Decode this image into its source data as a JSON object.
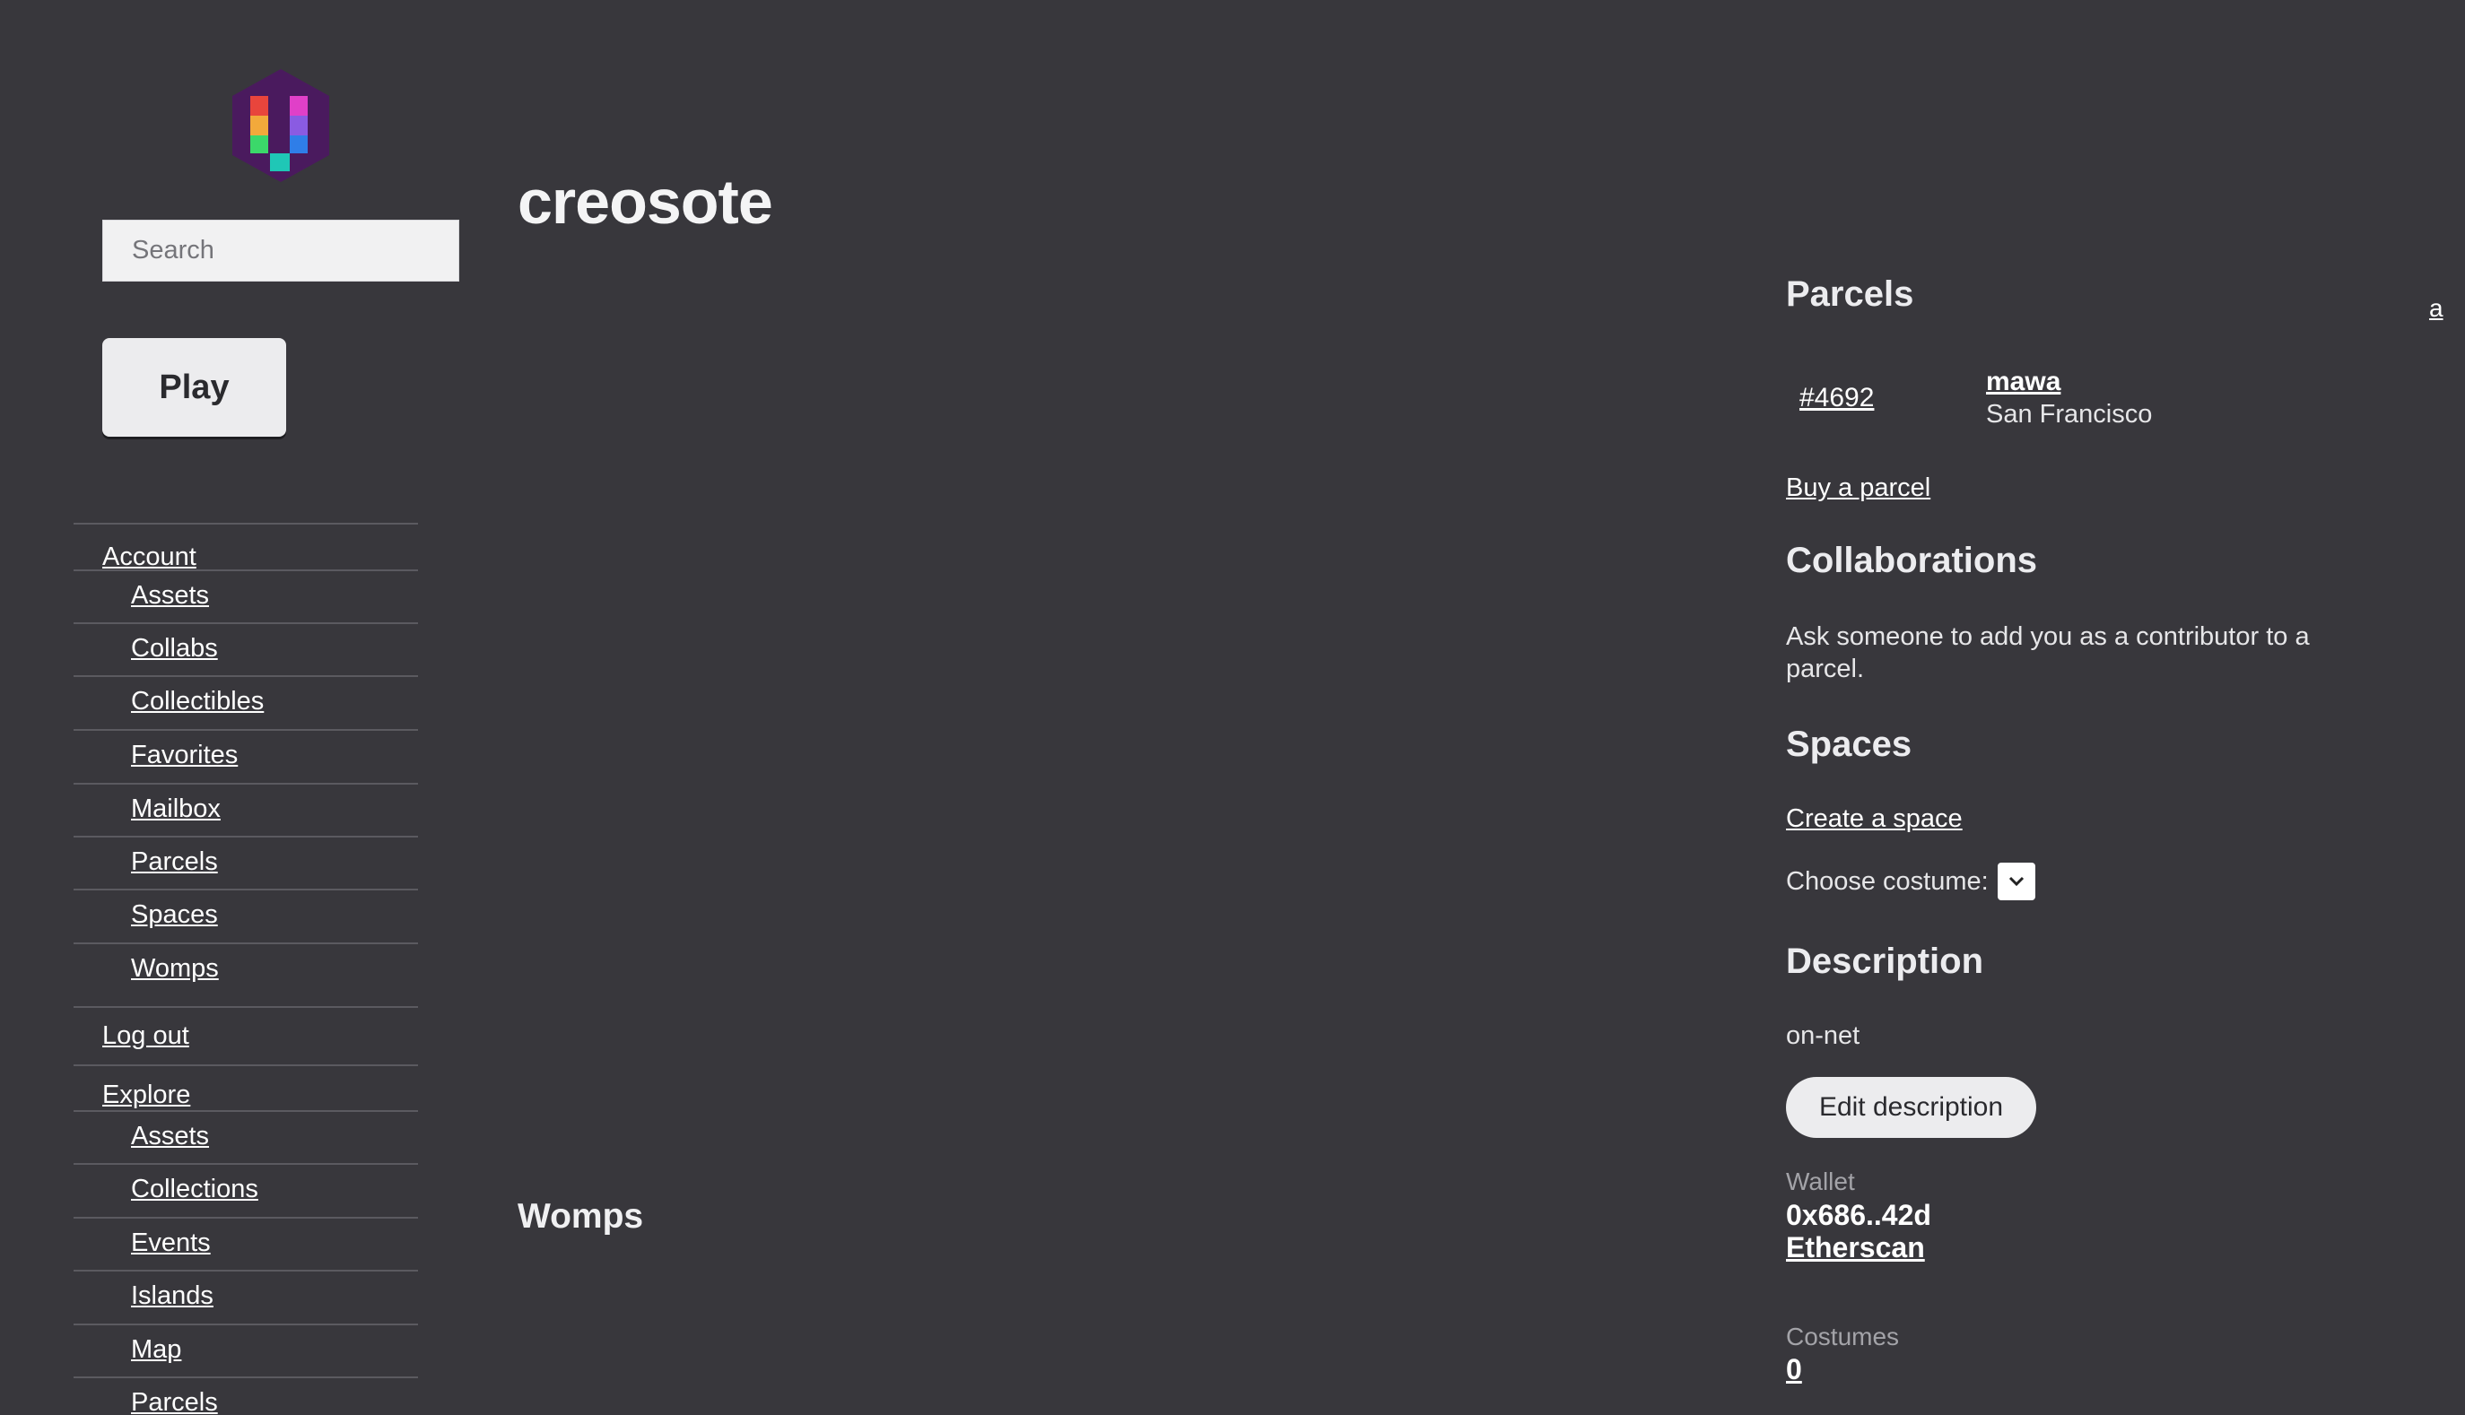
{
  "app": {
    "logo_colors": [
      "#4a1a5e",
      "#e8453c",
      "#f2a93b",
      "#8a2be2",
      "#e040c8",
      "#2f7ee8",
      "#3bd86a",
      "#1fc7b6"
    ]
  },
  "sidebar": {
    "search_placeholder": "Search",
    "play_label": "Play",
    "account_label": "Account",
    "account_items": [
      {
        "label": "Assets"
      },
      {
        "label": "Collabs"
      },
      {
        "label": "Collectibles"
      },
      {
        "label": "Favorites"
      },
      {
        "label": "Mailbox"
      },
      {
        "label": "Parcels"
      },
      {
        "label": "Spaces"
      },
      {
        "label": "Womps"
      }
    ],
    "logout_label": "Log out",
    "explore_label": "Explore",
    "explore_items": [
      {
        "label": "Assets"
      },
      {
        "label": "Collections"
      },
      {
        "label": "Events"
      },
      {
        "label": "Islands"
      },
      {
        "label": "Map"
      },
      {
        "label": "Parcels"
      }
    ]
  },
  "main": {
    "title": "creosote",
    "womps_heading": "Womps",
    "top_right_link": "a"
  },
  "right": {
    "parcels_heading": "Parcels",
    "parcel": {
      "id": "#4692",
      "owner": "mawa",
      "city": "San Francisco"
    },
    "buy_parcel": "Buy a parcel",
    "collab_heading": "Collaborations",
    "collab_text": "Ask someone to add you as a contributor to a parcel.",
    "spaces_heading": "Spaces",
    "create_space": "Create a space",
    "choose_costume_label": "Choose costume:",
    "description_heading": "Description",
    "description_text": "on-net",
    "edit_description": "Edit description",
    "wallet_label": "Wallet",
    "wallet_address": "0x686..42d",
    "etherscan": "Etherscan",
    "costumes_label": "Costumes",
    "costumes_count": "0"
  }
}
